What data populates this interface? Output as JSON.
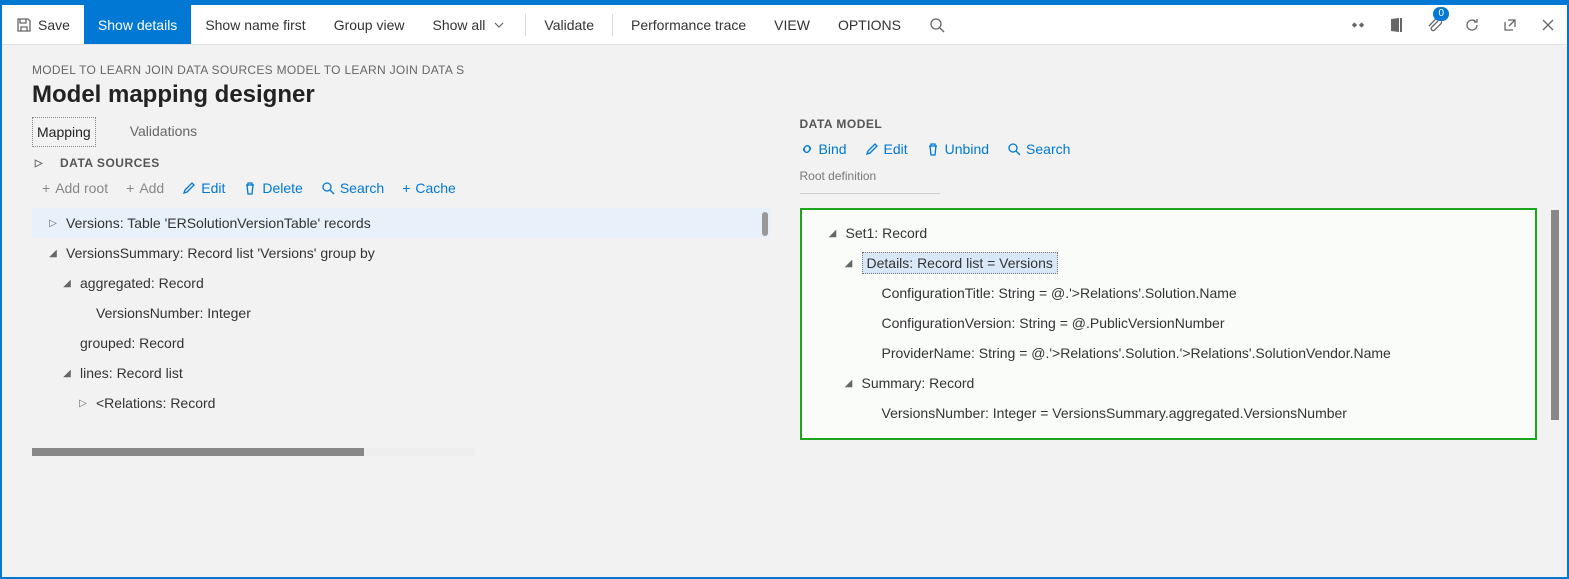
{
  "toolbar": {
    "save": "Save",
    "show_details": "Show details",
    "show_name_first": "Show name first",
    "group_view": "Group view",
    "show_all": "Show all",
    "validate": "Validate",
    "perf_trace": "Performance trace",
    "view": "VIEW",
    "options": "OPTIONS",
    "badge_count": "0"
  },
  "breadcrumb": "MODEL TO LEARN JOIN DATA SOURCES MODEL TO LEARN JOIN DATA S",
  "page_title": "Model mapping designer",
  "tabs": {
    "mapping": "Mapping",
    "validations": "Validations"
  },
  "ds": {
    "heading": "DATA SOURCES",
    "actions": {
      "add_root": "Add root",
      "add": "Add",
      "edit": "Edit",
      "delete": "Delete",
      "search": "Search",
      "cache": "Cache"
    },
    "tree": [
      {
        "indent": 0,
        "twist": "▷",
        "text": "Versions: Table 'ERSolutionVersionTable' records",
        "sel": true
      },
      {
        "indent": 0,
        "twist": "◢",
        "text": "VersionsSummary: Record list 'Versions' group by"
      },
      {
        "indent": 1,
        "twist": "◢",
        "text": "aggregated: Record"
      },
      {
        "indent": 2,
        "twist": "",
        "text": "VersionsNumber: Integer"
      },
      {
        "indent": 1,
        "twist": "",
        "text": "grouped: Record"
      },
      {
        "indent": 1,
        "twist": "◢",
        "text": "lines: Record list"
      },
      {
        "indent": 2,
        "twist": "▷",
        "text": "<Relations: Record"
      }
    ]
  },
  "dm": {
    "heading": "DATA MODEL",
    "actions": {
      "bind": "Bind",
      "edit": "Edit",
      "unbind": "Unbind",
      "search": "Search"
    },
    "root_label": "Root definition",
    "tree": [
      {
        "indent": 0,
        "twist": "◢",
        "text": "Set1: Record"
      },
      {
        "indent": 1,
        "twist": "◢",
        "text": "Details: Record list = Versions",
        "sel": true
      },
      {
        "indent": 2,
        "twist": "",
        "text": "ConfigurationTitle: String = @.'>Relations'.Solution.Name"
      },
      {
        "indent": 2,
        "twist": "",
        "text": "ConfigurationVersion: String = @.PublicVersionNumber"
      },
      {
        "indent": 2,
        "twist": "",
        "text": "ProviderName: String = @.'>Relations'.Solution.'>Relations'.SolutionVendor.Name"
      },
      {
        "indent": 1,
        "twist": "◢",
        "text": "Summary: Record"
      },
      {
        "indent": 2,
        "twist": "",
        "text": "VersionsNumber: Integer = VersionsSummary.aggregated.VersionsNumber"
      }
    ]
  }
}
